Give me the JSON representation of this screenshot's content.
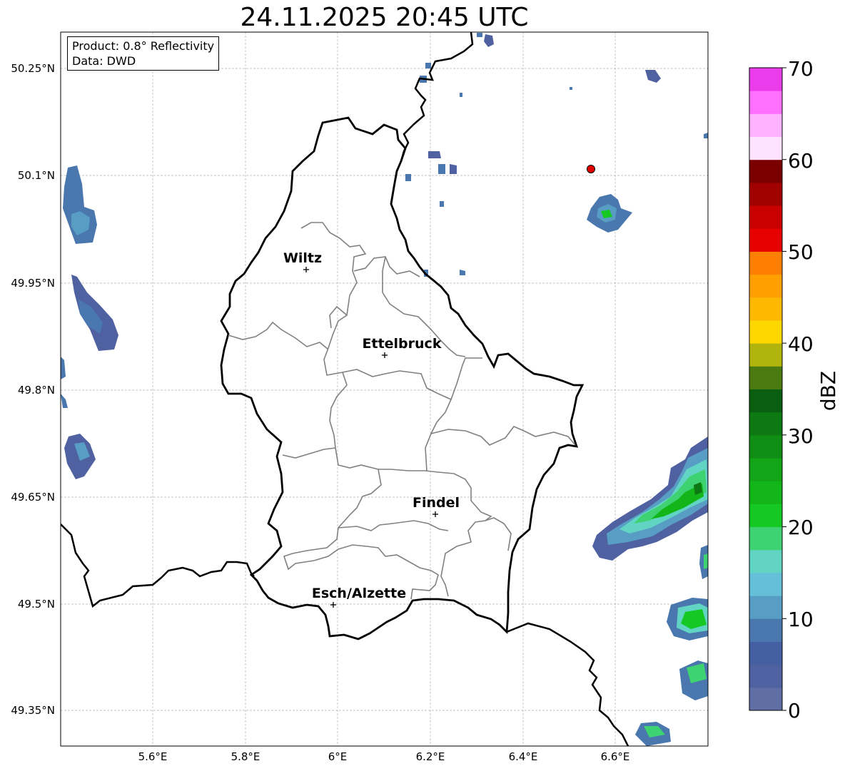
{
  "title": "24.11.2025 20:45 UTC",
  "info": {
    "product": "Product: 0.8° Reflectivity",
    "data": "Data: DWD"
  },
  "lat_ticks": [
    "50.25°N",
    "50.1°N",
    "49.95°N",
    "49.8°N",
    "49.65°N",
    "49.5°N",
    "49.35°N"
  ],
  "lon_ticks": [
    "5.6°E",
    "5.8°E",
    "6°E",
    "6.2°E",
    "6.4°E",
    "6.6°E"
  ],
  "cities": [
    {
      "name": "Wiltz"
    },
    {
      "name": "Ettelbruck"
    },
    {
      "name": "Findel"
    },
    {
      "name": "Esch/Alzette"
    }
  ],
  "colorbar": {
    "label": "dBZ",
    "ticks": [
      "0",
      "10",
      "20",
      "30",
      "40",
      "50",
      "60",
      "70"
    ],
    "colors": [
      "#5f6fa5",
      "#4f61a0",
      "#4560a2",
      "#4977ae",
      "#579dc4",
      "#66bfd9",
      "#61d4c4",
      "#3fd272",
      "#15c824",
      "#13b619",
      "#11a517",
      "#0f8d15",
      "#0c7912",
      "#0a5e0f",
      "#4a7a10",
      "#b0b40c",
      "#ffd700",
      "#ffb800",
      "#ff9f00",
      "#ff8000",
      "#e60000",
      "#c80000",
      "#a00000",
      "#7a0000",
      "#ffe2ff",
      "#ffb2ff",
      "#ff70ff",
      "#eb3ceb"
    ]
  },
  "marker_color": "#e00000"
}
